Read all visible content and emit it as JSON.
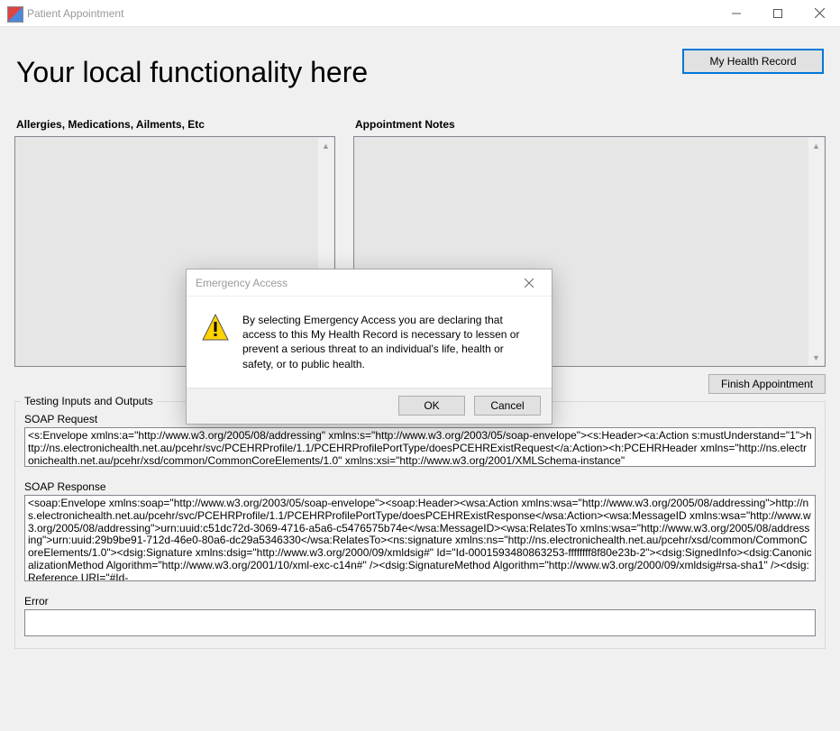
{
  "window": {
    "title": "Patient Appointment",
    "minimize_icon": "minimize-icon",
    "maximize_icon": "maximize-icon",
    "close_icon": "close-icon"
  },
  "header": {
    "heading": "Your local functionality here",
    "my_health_record_label": "My Health Record"
  },
  "sections": {
    "allergies_label": "Allergies, Medications, Ailments, Etc",
    "notes_label": "Appointment Notes",
    "finish_label": "Finish Appointment"
  },
  "testing": {
    "group_title": "Testing Inputs and Outputs",
    "soap_request_label": "SOAP Request",
    "soap_request_value": "<s:Envelope xmlns:a=\"http://www.w3.org/2005/08/addressing\" xmlns:s=\"http://www.w3.org/2003/05/soap-envelope\"><s:Header><a:Action s:mustUnderstand=\"1\">http://ns.electronichealth.net.au/pcehr/svc/PCEHRProfile/1.1/PCEHRProfilePortType/doesPCEHRExistRequest</a:Action><h:PCEHRHeader xmlns=\"http://ns.electronichealth.net.au/pcehr/xsd/common/CommonCoreElements/1.0\" xmlns:xsi=\"http://www.w3.org/2001/XMLSchema-instance\"",
    "soap_response_label": "SOAP Response",
    "soap_response_value": "<soap:Envelope xmlns:soap=\"http://www.w3.org/2003/05/soap-envelope\"><soap:Header><wsa:Action xmlns:wsa=\"http://www.w3.org/2005/08/addressing\">http://ns.electronichealth.net.au/pcehr/svc/PCEHRProfile/1.1/PCEHRProfilePortType/doesPCEHRExistResponse</wsa:Action><wsa:MessageID xmlns:wsa=\"http://www.w3.org/2005/08/addressing\">urn:uuid:c51dc72d-3069-4716-a5a6-c5476575b74e</wsa:MessageID><wsa:RelatesTo xmlns:wsa=\"http://www.w3.org/2005/08/addressing\">urn:uuid:29b9be91-712d-46e0-80a6-dc29a5346330</wsa:RelatesTo><ns:signature xmlns:ns=\"http://ns.electronichealth.net.au/pcehr/xsd/common/CommonCoreElements/1.0\"><dsig:Signature xmlns:dsig=\"http://www.w3.org/2000/09/xmldsig#\" Id=\"Id-0001593480863253-ffffffff8f80e23b-2\"><dsig:SignedInfo><dsig:CanonicalizationMethod Algorithm=\"http://www.w3.org/2001/10/xml-exc-c14n#\" /><dsig:SignatureMethod Algorithm=\"http://www.w3.org/2000/09/xmldsig#rsa-sha1\" /><dsig:Reference URI=\"#Id-",
    "error_label": "Error",
    "error_value": ""
  },
  "modal": {
    "title": "Emergency Access",
    "body": "By selecting Emergency Access you are declaring that access to this My Health Record is necessary to lessen or prevent a serious threat to an individual's life, health or safety, or to public health.",
    "ok_label": "OK",
    "cancel_label": "Cancel"
  }
}
